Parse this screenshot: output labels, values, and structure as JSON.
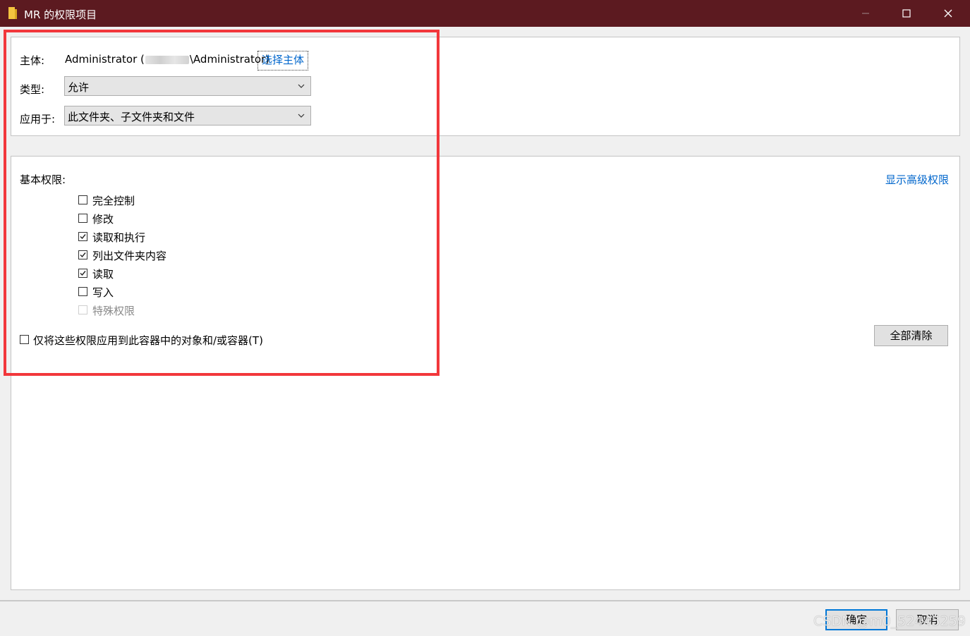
{
  "window": {
    "title": "MR 的权限项目",
    "title_bg": "#5c1a20",
    "buttons": {
      "minimize": "—",
      "maximize": "☐",
      "close": "✕"
    }
  },
  "principal": {
    "label": "主体:",
    "name_prefix": "Administrator (",
    "name_redacted_fragment": "…",
    "name_suffix": "\\Administrator)",
    "select_link": "选择主体"
  },
  "type": {
    "label": "类型:",
    "value": "允许"
  },
  "applies_to": {
    "label": "应用于:",
    "value": "此文件夹、子文件夹和文件"
  },
  "permissions": {
    "label": "基本权限:",
    "advanced_link": "显示高级权限",
    "items": [
      {
        "label": "完全控制",
        "checked": false,
        "disabled": false
      },
      {
        "label": "修改",
        "checked": false,
        "disabled": false
      },
      {
        "label": "读取和执行",
        "checked": true,
        "disabled": false
      },
      {
        "label": "列出文件夹内容",
        "checked": true,
        "disabled": false
      },
      {
        "label": "读取",
        "checked": true,
        "disabled": false
      },
      {
        "label": "写入",
        "checked": false,
        "disabled": false
      },
      {
        "label": "特殊权限",
        "checked": false,
        "disabled": true
      }
    ],
    "inherit_only": {
      "label": "仅将这些权限应用到此容器中的对象和/或容器(T)",
      "checked": false
    },
    "clear_all": "全部清除"
  },
  "footer": {
    "ok": "确定",
    "cancel": "取消"
  },
  "watermark": "CSDN @m0_52445259",
  "colors": {
    "link": "#0066cc",
    "highlight": "#f2373b",
    "default_button_border": "#0078d7"
  }
}
